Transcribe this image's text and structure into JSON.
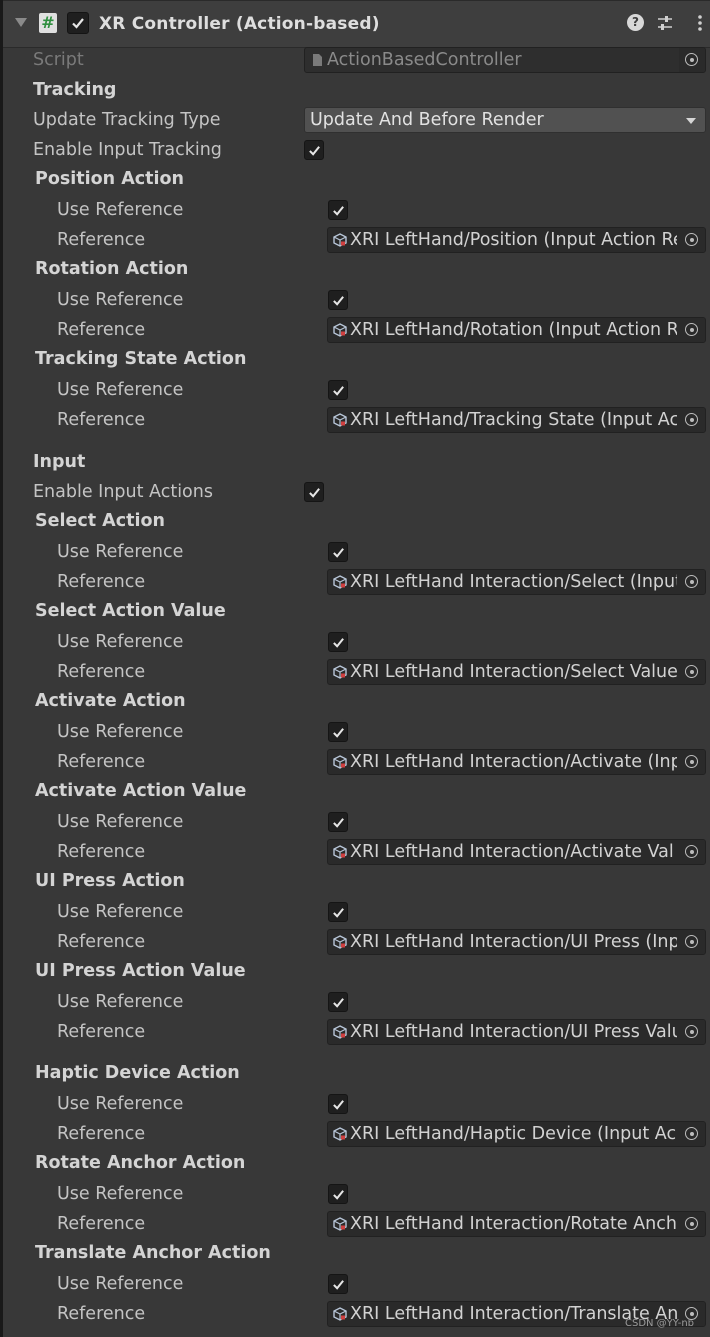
{
  "component": {
    "title": "XR Controller (Action-based)",
    "enabled": true,
    "script_label": "Script",
    "script_value": "ActionBasedController"
  },
  "tracking": {
    "header": "Tracking",
    "update_tracking_type_label": "Update Tracking Type",
    "update_tracking_type_value": "Update And Before Render",
    "enable_input_tracking_label": "Enable Input Tracking"
  },
  "input": {
    "header": "Input",
    "enable_input_actions_label": "Enable Input Actions"
  },
  "labels": {
    "use_reference": "Use Reference",
    "reference": "Reference"
  },
  "actions": [
    {
      "name": "Position Action",
      "reference": "XRI LeftHand/Position (Input Action Re"
    },
    {
      "name": "Rotation Action",
      "reference": "XRI LeftHand/Rotation (Input Action R"
    },
    {
      "name": "Tracking State Action",
      "reference": "XRI LeftHand/Tracking State (Input Ac"
    },
    {
      "name": "Select Action",
      "reference": "XRI LeftHand Interaction/Select (Input"
    },
    {
      "name": "Select Action Value",
      "reference": "XRI LeftHand Interaction/Select Value"
    },
    {
      "name": "Activate Action",
      "reference": "XRI LeftHand Interaction/Activate (Inp"
    },
    {
      "name": "Activate Action Value",
      "reference": "XRI LeftHand Interaction/Activate Val"
    },
    {
      "name": "UI Press Action",
      "reference": "XRI LeftHand Interaction/UI Press (Inp"
    },
    {
      "name": "UI Press Action Value",
      "reference": "XRI LeftHand Interaction/UI Press Valu"
    },
    {
      "name": "Haptic Device Action",
      "reference": "XRI LeftHand/Haptic Device (Input Ac"
    },
    {
      "name": "Rotate Anchor Action",
      "reference": "XRI LeftHand Interaction/Rotate Anch"
    },
    {
      "name": "Translate Anchor Action",
      "reference": "XRI LeftHand Interaction/Translate An"
    }
  ],
  "watermark": "CSDN @YY-nb",
  "colors": {
    "background": "#383838",
    "field": "#2a2a2a",
    "accent_green": "#2f8f3f"
  },
  "icons": [
    "foldout-arrow-icon",
    "script-icon",
    "help-icon",
    "preset-icon",
    "kebab-menu-icon",
    "object-picker-icon",
    "input-action-asset-icon"
  ]
}
